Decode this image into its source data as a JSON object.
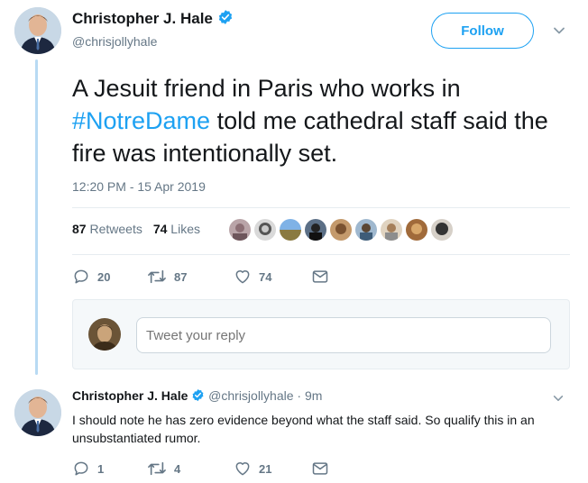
{
  "main_tweet": {
    "author_name": "Christopher J. Hale",
    "author_handle": "@chrisjollyhale",
    "follow_label": "Follow",
    "text_before": "A Jesuit friend in Paris who works in ",
    "hashtag": "#NotreDame",
    "text_after": " told me cathedral staff said the fire was intentionally set.",
    "timestamp": "12:20 PM - 15 Apr 2019",
    "retweets_count": "87",
    "retweets_label": "Retweets",
    "likes_count": "74",
    "likes_label": "Likes",
    "actions": {
      "replies": "20",
      "retweets": "87",
      "likes": "74"
    }
  },
  "reply_composer": {
    "placeholder": "Tweet your reply"
  },
  "reply_tweet": {
    "author_name": "Christopher J. Hale",
    "author_handle": "@chrisjollyhale",
    "time_ago": "· 9m",
    "text": "I should note he has zero evidence beyond what the staff said. So qualify this in an unsubstantiated rumor.",
    "actions": {
      "replies": "1",
      "retweets": "4",
      "likes": "21"
    }
  },
  "colors": {
    "accent": "#1da1f2",
    "muted": "#657786",
    "thread_line": "#b8daf3"
  },
  "icons": [
    "verified-badge-icon",
    "chevron-down-icon",
    "reply-icon",
    "retweet-icon",
    "like-icon",
    "direct-message-icon"
  ]
}
